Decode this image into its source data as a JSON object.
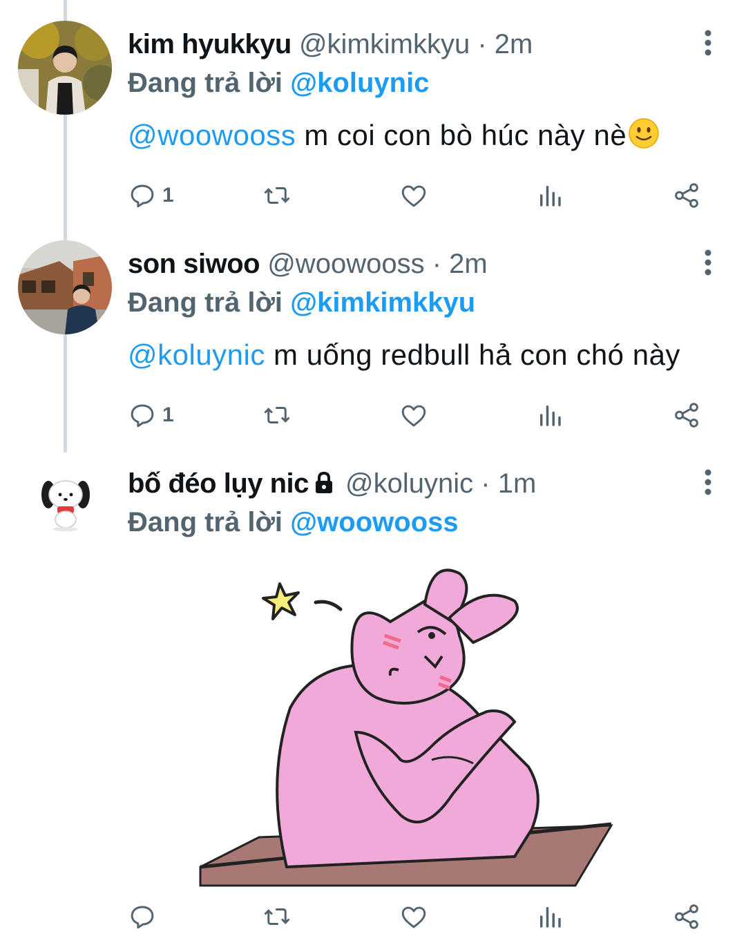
{
  "tweets": [
    {
      "display_name": "kim hyukkyu",
      "handle": "@kimkimkkyu",
      "time": "· 2m",
      "replying_prefix": "Đang trả lời",
      "replying_to": "@koluynic",
      "mention": "@woowooss",
      "text": " m coi con bò húc này nè",
      "emoji": "slightly-smiling-face",
      "reply_count": "1",
      "avatar": "photo-person-autumn"
    },
    {
      "display_name": "son siwoo",
      "handle": "@woowooss",
      "time": "· 2m",
      "replying_prefix": "Đang trả lời",
      "replying_to": "@kimkimkkyu",
      "mention": "@koluynic",
      "text": " m uống redbull hả con chó này",
      "reply_count": "1",
      "avatar": "photo-person-street"
    },
    {
      "display_name": "bố đéo lụy nic",
      "protected_icon": "lock-icon",
      "handle": "@koluynic",
      "time": "· 1m",
      "replying_prefix": "Đang trả lời",
      "replying_to": "@woowooss",
      "reply_count": "",
      "avatar": "white-puppy-character",
      "media": "pink-bunny-sticker-leaning-on-table"
    }
  ],
  "icons": [
    "reply-icon",
    "retweet-icon",
    "like-icon",
    "analytics-icon",
    "share-icon",
    "more-icon"
  ],
  "colors": {
    "accent": "#1d9bf0",
    "secondary_text": "#536471",
    "thread_line": "#cfd9de",
    "sticker_pink": "#f0a9d8"
  }
}
